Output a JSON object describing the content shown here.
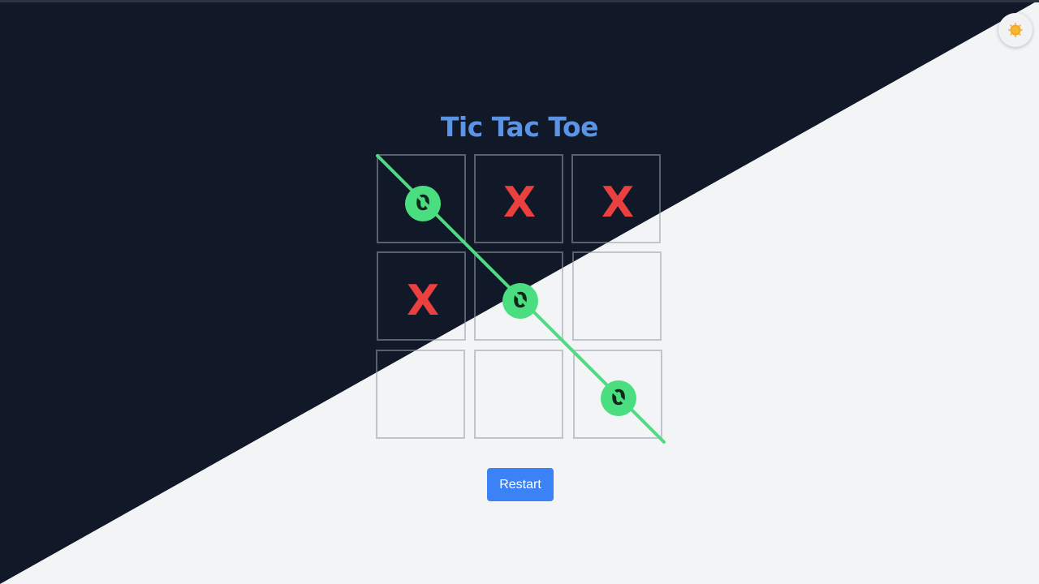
{
  "title": "Tic Tac Toe",
  "board": [
    {
      "row": 1,
      "col": 1,
      "mark": "O"
    },
    {
      "row": 1,
      "col": 2,
      "mark": "X"
    },
    {
      "row": 1,
      "col": 3,
      "mark": "X"
    },
    {
      "row": 2,
      "col": 1,
      "mark": "X"
    },
    {
      "row": 2,
      "col": 2,
      "mark": "O"
    },
    {
      "row": 2,
      "col": 3,
      "mark": ""
    },
    {
      "row": 3,
      "col": 1,
      "mark": ""
    },
    {
      "row": 3,
      "col": 2,
      "mark": ""
    },
    {
      "row": 3,
      "col": 3,
      "mark": "O"
    }
  ],
  "winner": "O",
  "winning_line": "diagonal top-left to bottom-right",
  "o_inner_glyph": "0",
  "restart_label": "Restart",
  "theme_toggle_icon": "sun-icon",
  "colors": {
    "dark_background": "#111827",
    "light_background": "#f2f4f6",
    "title": "#5b93e6",
    "x_mark": "#ea4040",
    "o_mark": "#4ade80",
    "win_line": "#4ade80",
    "button": "#3b82f6",
    "sun": "#f5a623"
  }
}
